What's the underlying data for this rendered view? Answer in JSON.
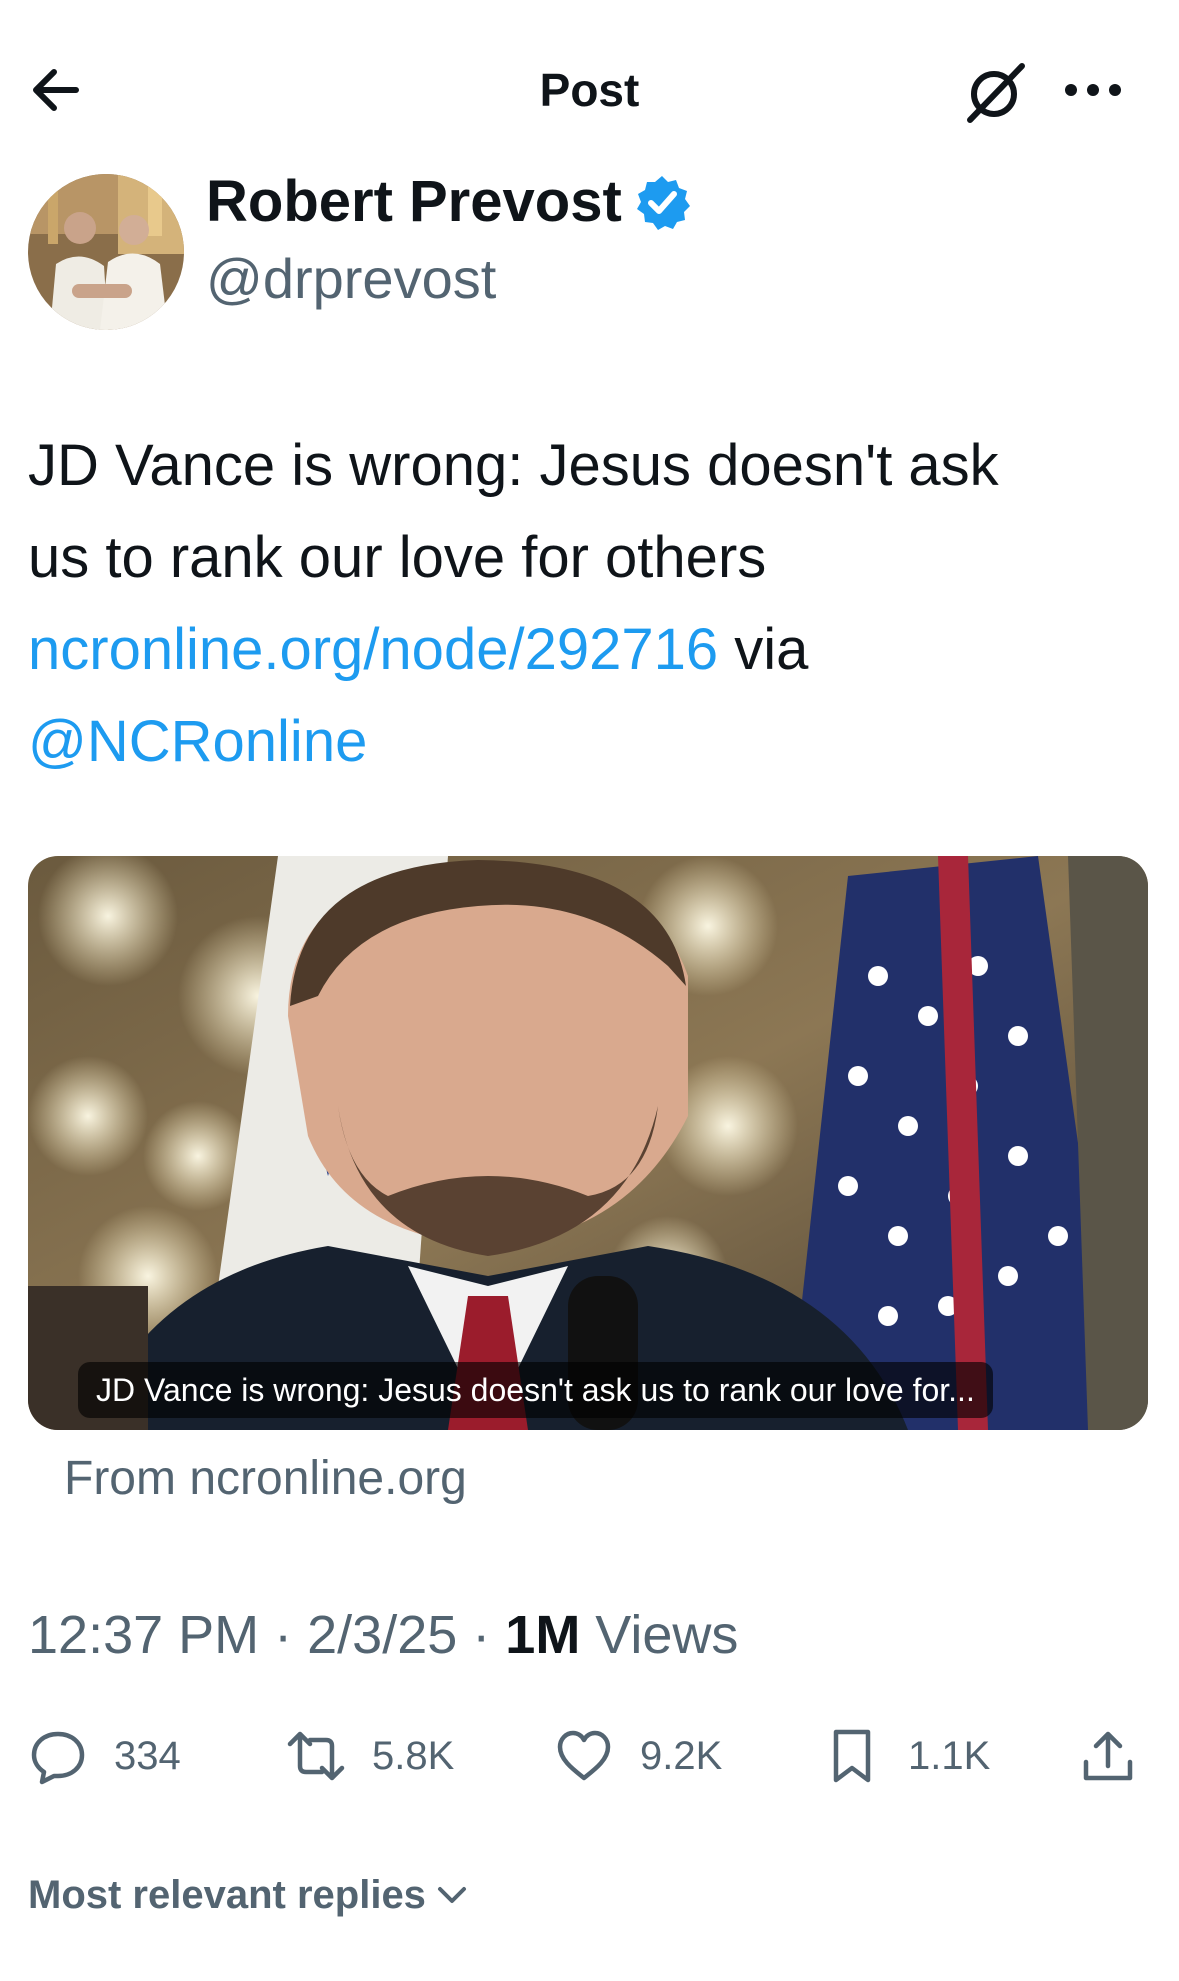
{
  "header": {
    "title": "Post",
    "back_icon": "arrow-left-icon",
    "grok_icon": "grok-icon",
    "more_icon": "more-horizontal-icon"
  },
  "post": {
    "author_name": "Robert Prevost",
    "author_handle": "@drprevost",
    "verified": true,
    "text_line1": "JD Vance is wrong: Jesus doesn't ask",
    "text_line2": "us to rank our love for others",
    "link_text": "ncronline.org/node/292716",
    "text_via": " via",
    "mention": "@NCRonline",
    "card": {
      "caption": "JD Vance is wrong: Jesus doesn't ask us to rank our love for...",
      "source": "From ncronline.org"
    },
    "time": "12:37 PM",
    "date": "2/3/25",
    "separator": " · ",
    "views_count": "1M",
    "views_label": " Views",
    "actions": {
      "replies": "334",
      "reposts": "5.8K",
      "likes": "9.2K",
      "bookmarks": "1.1K"
    }
  },
  "replies_sort": {
    "label": "Most relevant replies"
  },
  "colors": {
    "link": "#1d9bf0",
    "secondary_text": "#536471",
    "primary_text": "#0f1419"
  }
}
